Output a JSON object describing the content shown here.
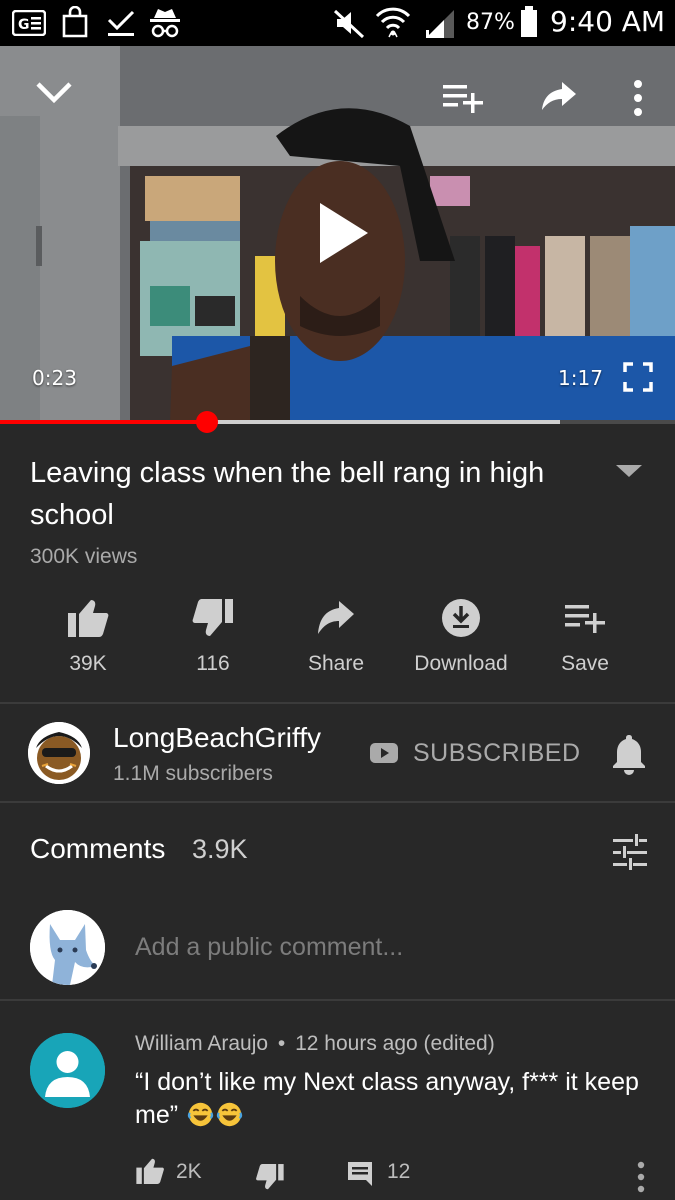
{
  "status_bar": {
    "battery": "87%",
    "time": "9:40 AM"
  },
  "player": {
    "current_time": "0:23",
    "duration": "1:17",
    "progress": 0.306,
    "buffered": 0.83
  },
  "video": {
    "title": "Leaving class when the bell rang in high school",
    "views": "300K views"
  },
  "actions": {
    "like": "39K",
    "dislike": "116",
    "share": "Share",
    "download": "Download",
    "save": "Save"
  },
  "channel": {
    "name": "LongBeachGriffy",
    "subscribers": "1.1M subscribers",
    "subscribe_state": "SUBSCRIBED"
  },
  "comments": {
    "title": "Comments",
    "count": "3.9K",
    "placeholder": "Add a public comment...",
    "items": [
      {
        "author": "William Araujo",
        "separator": "•",
        "time": "12 hours ago (edited)",
        "text": "“I don’t like my Next class anyway, f*** it keep me”",
        "emoji": "face-with-tears-of-joy",
        "likes": "2K",
        "replies": "12"
      }
    ]
  },
  "colors": {
    "background": "#282828",
    "accent_red": "#ff0000",
    "secondary_text": "#aaaaaa",
    "avatar_teal": "#18a5b8"
  }
}
